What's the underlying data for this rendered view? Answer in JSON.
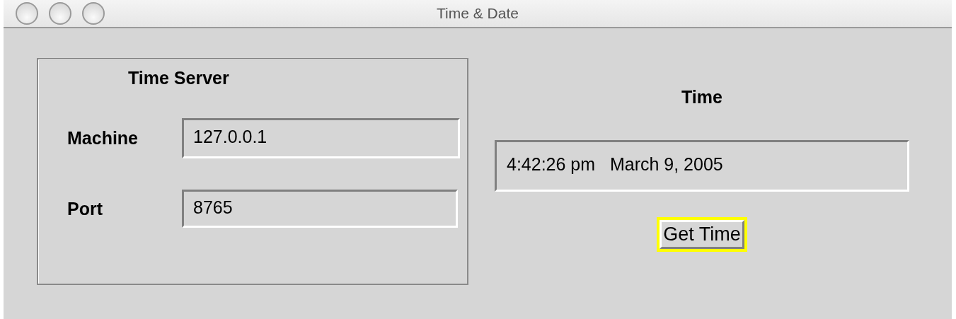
{
  "window": {
    "title": "Time & Date"
  },
  "server_panel": {
    "title": "Time Server",
    "fields": [
      {
        "label": "Machine",
        "value": "127.0.0.1"
      },
      {
        "label": "Port",
        "value": "8765"
      }
    ]
  },
  "time_panel": {
    "title": "Time",
    "value": "4:42:26 pm   March 9, 2005",
    "button": {
      "label": "Get Time",
      "focused": true
    }
  }
}
